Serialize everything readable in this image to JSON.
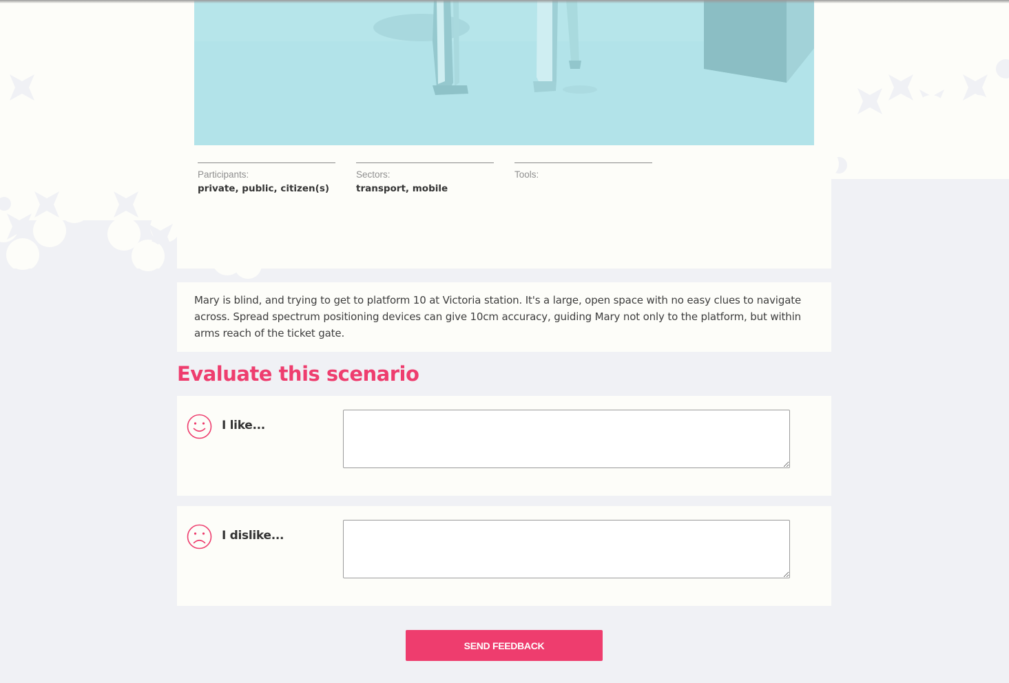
{
  "scenario": {
    "meta": [
      {
        "label": "Participants:",
        "value": "private, public, citizen(s)"
      },
      {
        "label": "Sectors:",
        "value": "transport, mobile"
      },
      {
        "label": "Tools:",
        "value": ""
      }
    ],
    "description": "Mary is blind, and trying to get to platform 10 at Victoria station. It's a large, open space with no easy clues to navigate across. Spread spectrum positioning devices can give 10cm accuracy, guiding Mary not only to the platform, but within arms reach of the ticket gate."
  },
  "evaluate": {
    "title": "Evaluate this scenario",
    "like": {
      "label": "I like...",
      "icon": "smiley-face-icon",
      "value": "",
      "placeholder": ""
    },
    "dislike": {
      "label": "I dislike...",
      "icon": "sad-face-icon",
      "value": "",
      "placeholder": ""
    }
  },
  "send_button": "SEND FEEDBACK",
  "colors": {
    "accent": "#ee3d6e",
    "background": "#f0f1f5",
    "card": "#fdfdf9",
    "image_tint": "#b2e3e9"
  }
}
